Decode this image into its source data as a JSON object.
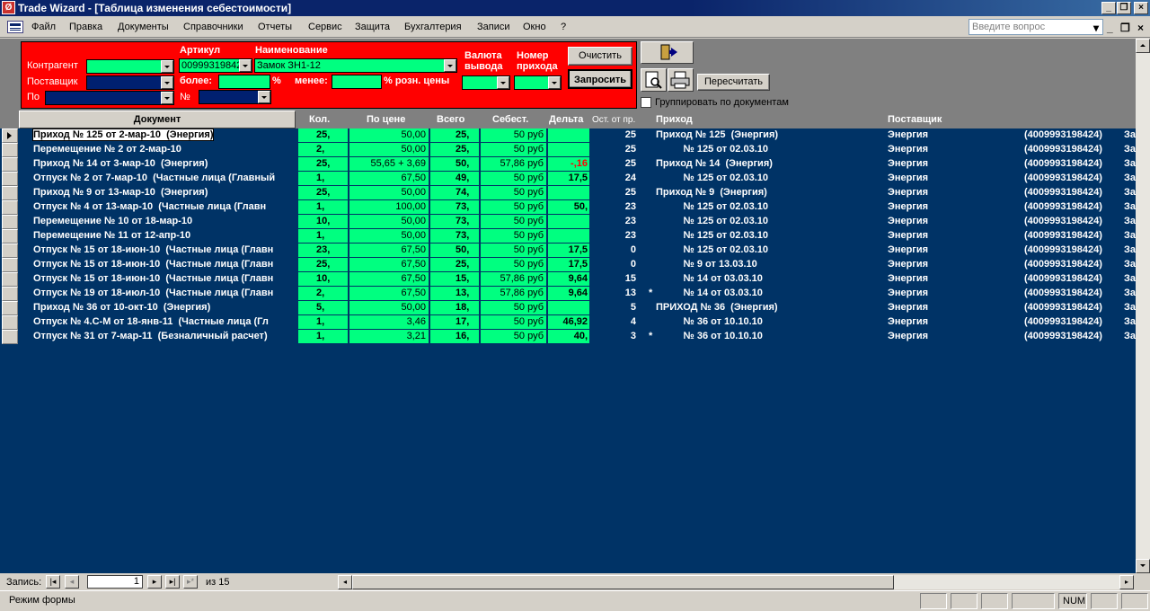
{
  "window": {
    "title": "Trade Wizard - [Таблица изменения себестоимости]"
  },
  "menu": {
    "items": [
      "Файл",
      "Правка",
      "Документы",
      "Справочники",
      "Отчеты",
      "Сервис",
      "Защита",
      "Бухгалтерия",
      "Записи",
      "Окно",
      "?"
    ],
    "question_placeholder": "Введите вопрос"
  },
  "filters": {
    "kontragent_label": "Контрагент",
    "postavshik_label": "Поставщик",
    "po_label": "По",
    "artikul_label": "Артикул",
    "artikul_value": "00999319842",
    "naimenovanie_label": "Наименование",
    "naimenovanie_value": "Замок ЗН1-12",
    "bolee_label": "более:",
    "menee_label": "менее:",
    "percent1": "%",
    "percent2": "% розн. цены",
    "num_label": "№",
    "valuta_label_1": "Валюта",
    "valuta_label_2": "вывода",
    "nomer_label_1": "Номер",
    "nomer_label_2": "прихода",
    "clear_button": "Очистить",
    "query_button": "Запросить"
  },
  "toolbar": {
    "recalc_button": "Пересчитать",
    "group_checkbox_label": "Группировать по документам"
  },
  "columns": {
    "doc": "Документ",
    "kol": "Кол.",
    "price": "По цене",
    "total": "Всего",
    "cost": "Себест.",
    "delta": "Дельта",
    "ost": "Ост. от пр.",
    "prihod": "Приход",
    "supplier": "Поставщик"
  },
  "rows": [
    {
      "doc": "Приход № 125 от 2-мар-10  (Энергия)",
      "kol": "25,",
      "price": "50,00",
      "total": "25,",
      "cost": "50 руб",
      "delta": "",
      "ost": "25",
      "star": "",
      "prihod": "Приход № 125  (Энергия)",
      "supplier": "Энергия",
      "code": "(4009993198424)",
      "extra": "За"
    },
    {
      "doc": "Перемещение № 2 от 2-мар-10",
      "kol": "2,",
      "price": "50,00",
      "total": "25,",
      "cost": "50 руб",
      "delta": "",
      "ost": "25",
      "star": "",
      "prihod": "          № 125 от 02.03.10",
      "supplier": "Энергия",
      "code": "(4009993198424)",
      "extra": "За"
    },
    {
      "doc": "Приход № 14 от 3-мар-10  (Энергия)",
      "kol": "25,",
      "price": "55,65 + 3,69",
      "total": "50,",
      "cost": "57,86 руб",
      "delta": "-,16",
      "neg": true,
      "ost": "25",
      "star": "",
      "prihod": "Приход № 14  (Энергия)",
      "supplier": "Энергия",
      "code": "(4009993198424)",
      "extra": "За"
    },
    {
      "doc": "Отпуск № 2 от 7-мар-10  (Частные лица (Главный",
      "kol": "1,",
      "price": "67,50",
      "total": "49,",
      "cost": "50 руб",
      "delta": "17,5",
      "ost": "24",
      "star": "",
      "prihod": "          № 125 от 02.03.10",
      "supplier": "Энергия",
      "code": "(4009993198424)",
      "extra": "За"
    },
    {
      "doc": "Приход № 9 от 13-мар-10  (Энергия)",
      "kol": "25,",
      "price": "50,00",
      "total": "74,",
      "cost": "50 руб",
      "delta": "",
      "ost": "25",
      "star": "",
      "prihod": "Приход № 9  (Энергия)",
      "supplier": "Энергия",
      "code": "(4009993198424)",
      "extra": "За"
    },
    {
      "doc": "Отпуск № 4 от 13-мар-10  (Частные лица (Главн",
      "kol": "1,",
      "price": "100,00",
      "total": "73,",
      "cost": "50 руб",
      "delta": "50,",
      "ost": "23",
      "star": "",
      "prihod": "          № 125 от 02.03.10",
      "supplier": "Энергия",
      "code": "(4009993198424)",
      "extra": "За"
    },
    {
      "doc": "Перемещение № 10 от 18-мар-10",
      "kol": "10,",
      "price": "50,00",
      "total": "73,",
      "cost": "50 руб",
      "delta": "",
      "ost": "23",
      "star": "",
      "prihod": "          № 125 от 02.03.10",
      "supplier": "Энергия",
      "code": "(4009993198424)",
      "extra": "За"
    },
    {
      "doc": "Перемещение № 11 от 12-апр-10",
      "kol": "1,",
      "price": "50,00",
      "total": "73,",
      "cost": "50 руб",
      "delta": "",
      "ost": "23",
      "star": "",
      "prihod": "          № 125 от 02.03.10",
      "supplier": "Энергия",
      "code": "(4009993198424)",
      "extra": "За"
    },
    {
      "doc": "Отпуск № 15 от 18-июн-10  (Частные лица (Главн",
      "kol": "23,",
      "price": "67,50",
      "total": "50,",
      "cost": "50 руб",
      "delta": "17,5",
      "ost": "0",
      "star": "",
      "prihod": "          № 125 от 02.03.10",
      "supplier": "Энергия",
      "code": "(4009993198424)",
      "extra": "За"
    },
    {
      "doc": "Отпуск № 15 от 18-июн-10  (Частные лица (Главн",
      "kol": "25,",
      "price": "67,50",
      "total": "25,",
      "cost": "50 руб",
      "delta": "17,5",
      "ost": "0",
      "star": "",
      "prihod": "          № 9 от 13.03.10",
      "supplier": "Энергия",
      "code": "(4009993198424)",
      "extra": "За"
    },
    {
      "doc": "Отпуск № 15 от 18-июн-10  (Частные лица (Главн",
      "kol": "10,",
      "price": "67,50",
      "total": "15,",
      "cost": "57,86 руб",
      "delta": "9,64",
      "ost": "15",
      "star": "",
      "prihod": "          № 14 от 03.03.10",
      "supplier": "Энергия",
      "code": "(4009993198424)",
      "extra": "За"
    },
    {
      "doc": "Отпуск № 19 от 18-июл-10  (Частные лица (Главн",
      "kol": "2,",
      "price": "67,50",
      "total": "13,",
      "cost": "57,86 руб",
      "delta": "9,64",
      "ost": "13",
      "star": "*",
      "prihod": "          № 14 от 03.03.10",
      "supplier": "Энергия",
      "code": "(4009993198424)",
      "extra": "За"
    },
    {
      "doc": "Приход № 36 от 10-окт-10  (Энергия)",
      "kol": "5,",
      "price": "50,00",
      "total": "18,",
      "cost": "50 руб",
      "delta": "",
      "ost": "5",
      "star": "",
      "prihod": "ПРИХОД № 36  (Энергия)",
      "supplier": "Энергия",
      "code": "(4009993198424)",
      "extra": "За"
    },
    {
      "doc": "Отпуск № 4.С-М от 18-янв-11  (Частные лица (Гл",
      "kol": "1,",
      "price": "3,46",
      "total": "17,",
      "cost": "50 руб",
      "delta": "46,92",
      "ost": "4",
      "star": "",
      "prihod": "          № 36 от 10.10.10",
      "supplier": "Энергия",
      "code": "(4009993198424)",
      "extra": "За"
    },
    {
      "doc": "Отпуск № 31 от 7-мар-11  (Безналичный расчет)",
      "kol": "1,",
      "price": "3,21",
      "total": "16,",
      "cost": "50 руб",
      "delta": "40,",
      "ost": "3",
      "star": "*",
      "prihod": "          № 36 от 10.10.10",
      "supplier": "Энергия",
      "code": "(4009993198424)",
      "extra": "За"
    }
  ],
  "nav": {
    "label": "Запись:",
    "current": "1",
    "of_label": "из  15"
  },
  "status": {
    "mode": "Режим формы",
    "num": "NUM"
  }
}
